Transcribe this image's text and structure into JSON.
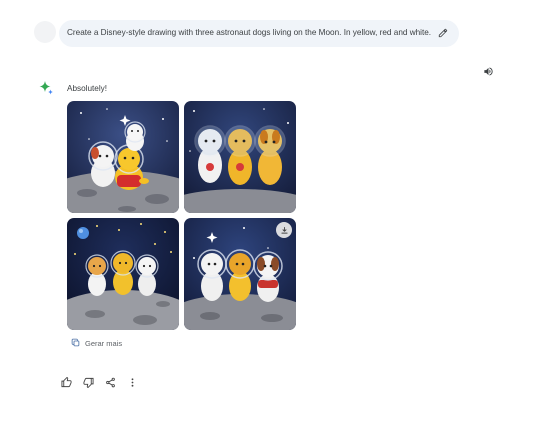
{
  "conversation": {
    "user_prompt": "Create a Disney-style drawing with three astronaut dogs living on the Moon. In yellow, red and white.",
    "reply_text": "Absolutely!",
    "generate_more_label": "Gerar mais"
  },
  "icons": {
    "edit": "pencil-icon",
    "speaker": "speaker-icon",
    "assistant": "gemini-sparkle-icon",
    "download": "download-icon",
    "generate_more": "image-grid-icon",
    "thumbs_up": "thumbs-up-icon",
    "thumbs_down": "thumbs-down-icon",
    "share": "share-icon",
    "more": "more-vertical-icon"
  },
  "colors": {
    "prompt_bubble": "#f0f4f9",
    "text": "#3c4043",
    "muted": "#5f6368",
    "gem_blue": "#4285f4",
    "gem_green": "#34a853"
  }
}
